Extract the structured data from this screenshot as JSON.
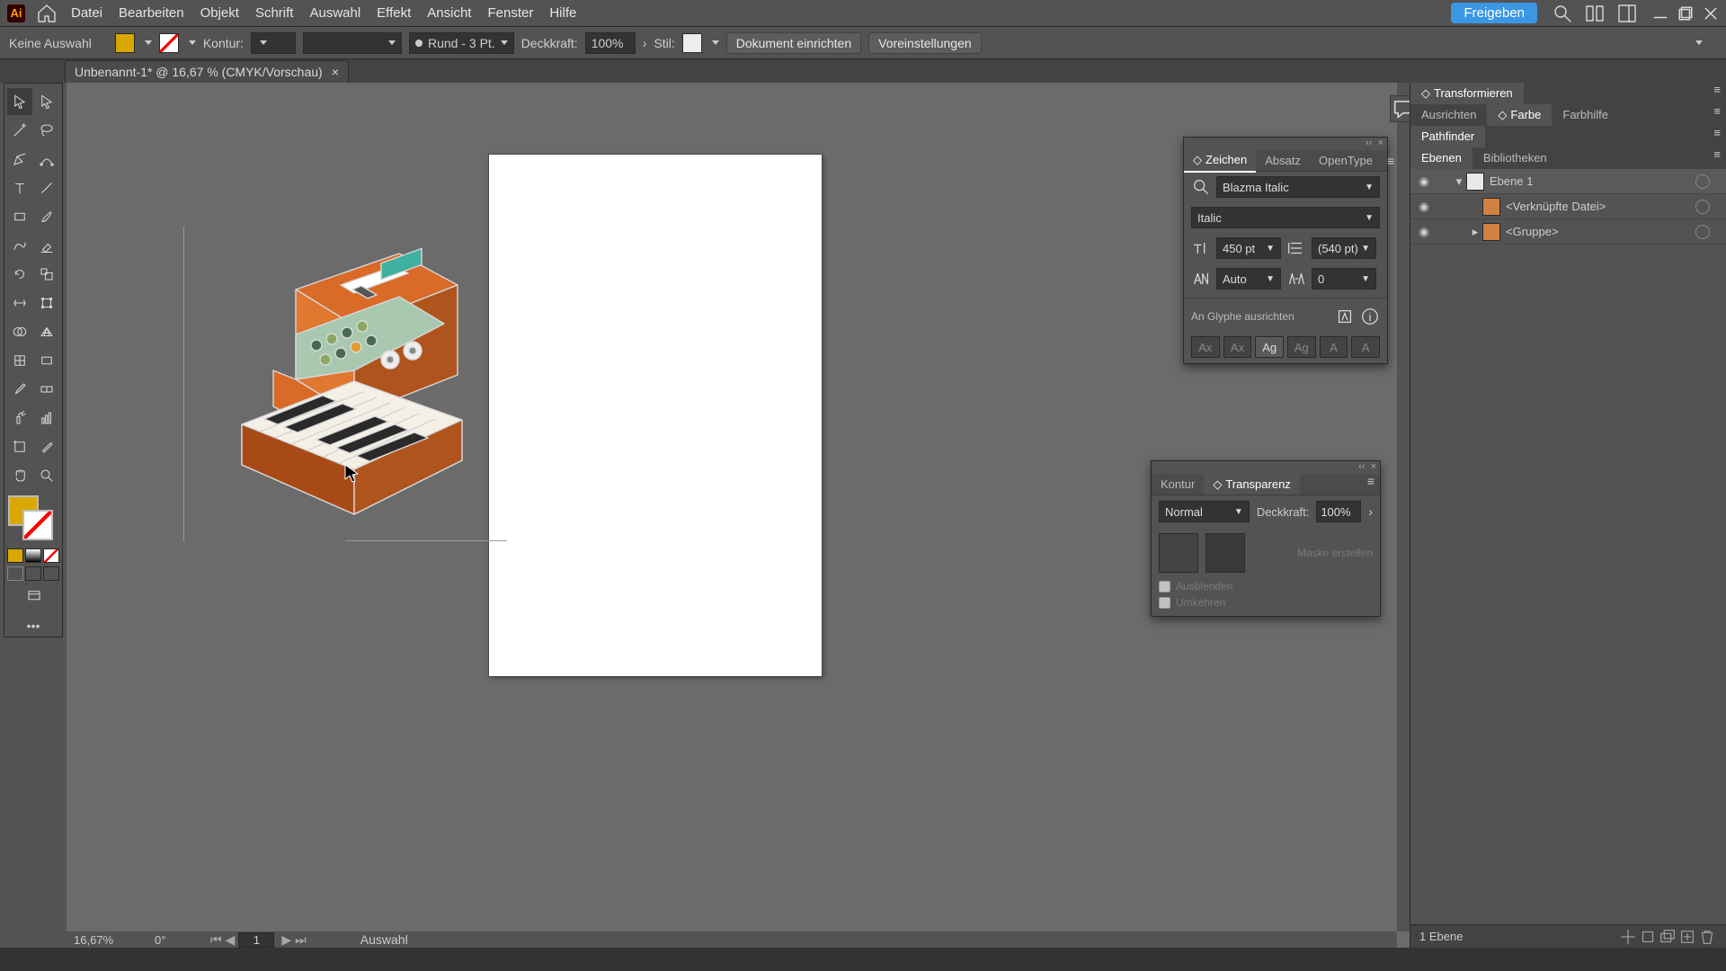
{
  "app": {
    "logo_letters": "Ai"
  },
  "menu": {
    "items": [
      "Datei",
      "Bearbeiten",
      "Objekt",
      "Schrift",
      "Auswahl",
      "Effekt",
      "Ansicht",
      "Fenster",
      "Hilfe"
    ]
  },
  "topright": {
    "share": "Freigeben"
  },
  "options": {
    "no_selection": "Keine Auswahl",
    "stroke_label": "Kontur:",
    "stroke_profile": "Rund - 3 Pt.",
    "opacity_label": "Deckkraft:",
    "opacity_value": "100%",
    "style_label": "Stil:",
    "doc_setup": "Dokument einrichten",
    "prefs": "Voreinstellungen"
  },
  "tab": {
    "title": "Unbenannt-1* @ 16,67 % (CMYK/Vorschau)",
    "close": "×"
  },
  "status": {
    "zoom": "16,67%",
    "rotation": "0°",
    "artboard": "1",
    "tool": "Auswahl"
  },
  "char_panel": {
    "tabs": [
      "Zeichen",
      "Absatz",
      "OpenType"
    ],
    "font": "Blazma Italic",
    "style": "Italic",
    "size": "450 pt",
    "leading": "(540 pt)",
    "kerning": "Auto",
    "tracking": "0",
    "snap": "An Glyphe ausrichten",
    "btns": [
      "Ax",
      "Ax",
      "Ag",
      "Ag",
      "A",
      "A"
    ]
  },
  "trans_panel": {
    "tabs": [
      "Kontur",
      "Transparenz"
    ],
    "mode": "Normal",
    "opacity_label": "Deckkraft:",
    "opacity_value": "100%",
    "mask_btn": "Maske erstellen",
    "cb1": "Ausblenden",
    "cb2": "Umkehren"
  },
  "dock": {
    "tabs1": [
      "Transformieren"
    ],
    "tabs2": [
      "Ausrichten",
      "Farbe",
      "Farbhilfe"
    ],
    "tabs3": [
      "Pathfinder"
    ],
    "tabs4": [
      "Ebenen",
      "Bibliotheken"
    ],
    "layers": [
      {
        "name": "Ebene 1",
        "expanded": true,
        "top": true
      },
      {
        "name": "<Verknüpfte Datei>",
        "indent": 1
      },
      {
        "name": "<Gruppe>",
        "indent": 1,
        "expandable": true
      }
    ],
    "footer": "1 Ebene"
  }
}
